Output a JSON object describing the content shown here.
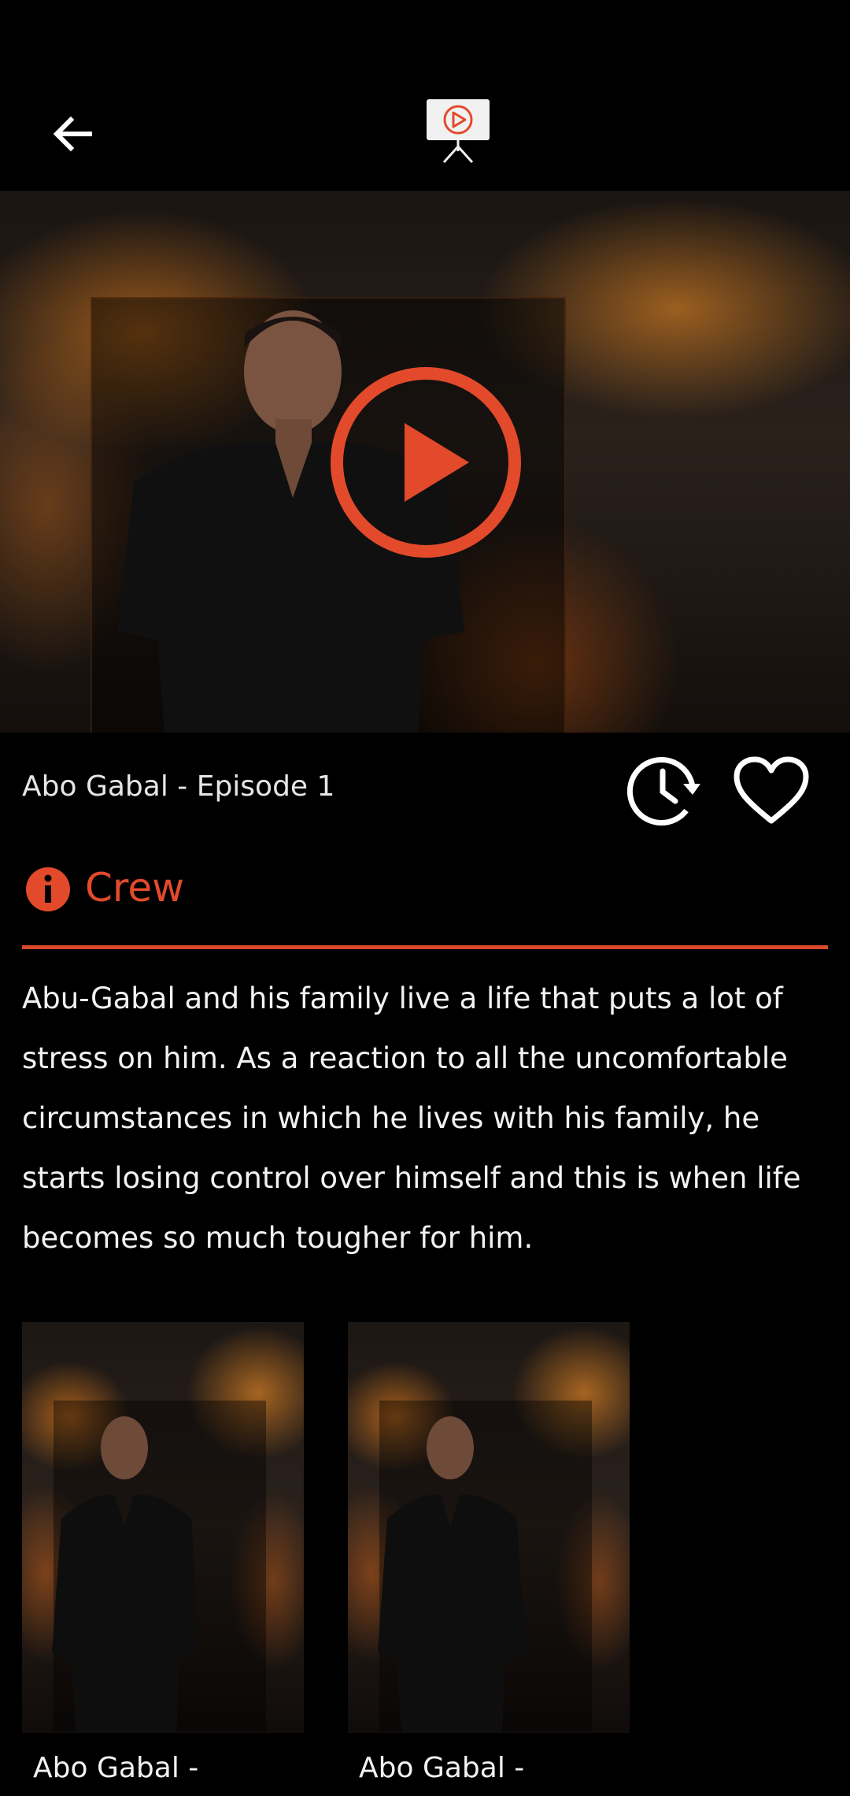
{
  "header": {
    "back_icon": "arrow-left-icon",
    "logo_icon": "tv-play-icon"
  },
  "hero": {
    "play_icon": "play-circle-icon",
    "accent_color": "#e24a2b"
  },
  "episode": {
    "title": "Abo Gabal - Episode 1",
    "history_icon": "clock-history-icon",
    "favorite_icon": "heart-outline-icon"
  },
  "crew": {
    "label": "Crew",
    "icon": "info-icon"
  },
  "description": "Abu-Gabal and his family live a life that puts a lot of stress on him. As a reaction to all the uncomfortable circumstances in which he lives with his family, he starts losing control over himself and this is when life becomes so much tougher for him.",
  "episodes": [
    {
      "caption": "Abo Gabal -"
    },
    {
      "caption": "Abo Gabal -"
    }
  ]
}
